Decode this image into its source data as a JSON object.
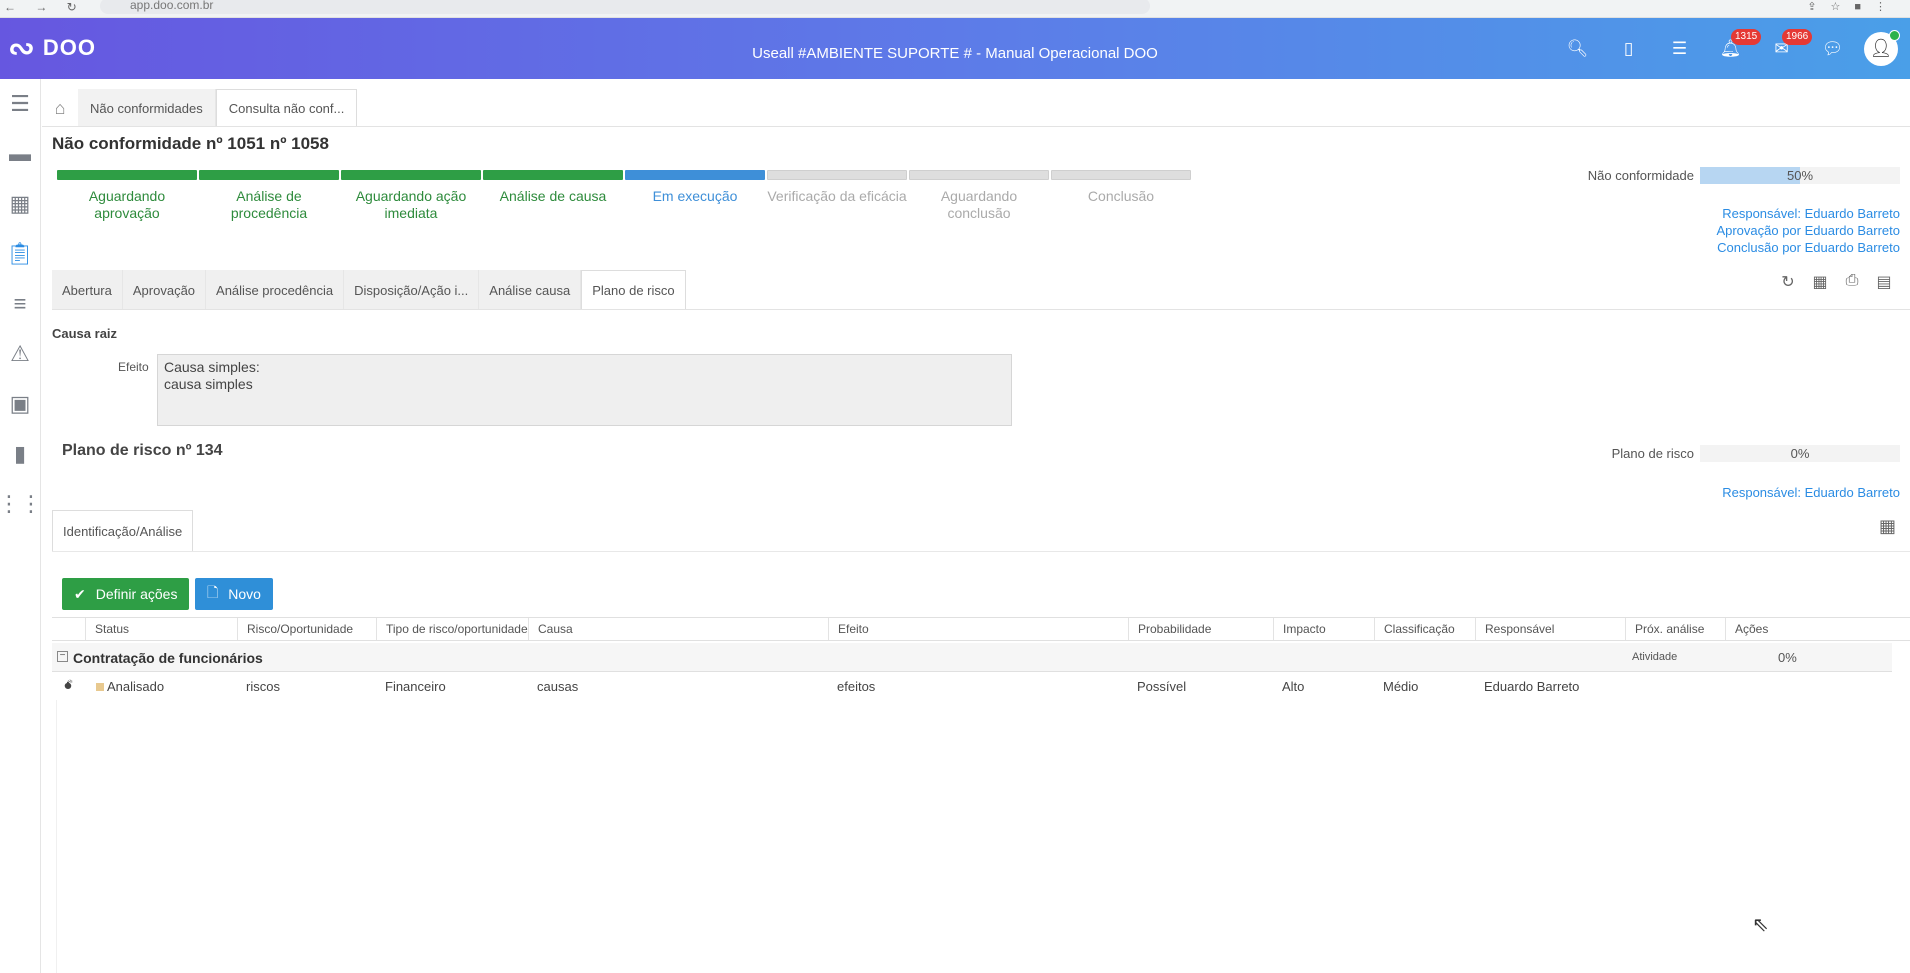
{
  "browser": {
    "url": "app.doo.com.br"
  },
  "header": {
    "logo_text": "DOO",
    "title": "Useall #AMBIENTE SUPORTE # - Manual Operacional DOO",
    "icons": [
      "search-icon",
      "mobile-icon",
      "list-icon",
      "bell-icon",
      "mail-icon",
      "chat-icon"
    ],
    "notifications_count": "1315",
    "mail_count": "1966"
  },
  "sidebar": {
    "items": [
      "menu-icon",
      "folder-icon",
      "calendar-icon",
      "clipboard-icon",
      "notes-icon",
      "warning-icon",
      "contact-icon",
      "chart-icon",
      "apps-icon"
    ]
  },
  "tabs": {
    "items": [
      {
        "label": "Não conformidades"
      },
      {
        "label": "Consulta não conf..."
      }
    ]
  },
  "page": {
    "title": "Não conformidade nº 1051 nº 1058"
  },
  "stages": [
    {
      "label": "Aguardando aprovação",
      "state": "done"
    },
    {
      "label": "Análise de procedência",
      "state": "done"
    },
    {
      "label": "Aguardando ação imediata",
      "state": "done"
    },
    {
      "label": "Análise de causa",
      "state": "done"
    },
    {
      "label": "Em execução",
      "state": "current"
    },
    {
      "label": "Verificação da eficácia",
      "state": "pending"
    },
    {
      "label": "Aguardando conclusão",
      "state": "pending"
    },
    {
      "label": "Conclusão",
      "state": "pending"
    }
  ],
  "nc_progress": {
    "label": "Não conformidade",
    "value_text": "50%",
    "value": 0.5
  },
  "nc_resp": {
    "responsavel": "Responsável: Eduardo Barreto",
    "aprovacao": "Aprovação por Eduardo Barreto",
    "conclusao": "Conclusão por Eduardo Barreto"
  },
  "subtabs": [
    {
      "label": "Abertura"
    },
    {
      "label": "Aprovação"
    },
    {
      "label": "Análise procedência"
    },
    {
      "label": "Disposição/Ação i..."
    },
    {
      "label": "Análise causa"
    },
    {
      "label": "Plano de risco"
    }
  ],
  "tools": [
    "refresh-icon",
    "calendar-icon",
    "print-icon",
    "comment-icon"
  ],
  "causa": {
    "section_title": "Causa raiz",
    "efeito_label": "Efeito",
    "efeito_value": "Causa simples:\ncausa simples"
  },
  "plan": {
    "title": "Plano de risco nº 134",
    "progress_label": "Plano de risco",
    "progress_text": "0%",
    "progress": 0,
    "responsavel": "Responsável: Eduardo Barreto",
    "tab_label": "Identificação/Análise"
  },
  "buttons": {
    "definir": "Definir ações",
    "novo": "Novo"
  },
  "table": {
    "columns": [
      "Status",
      "Risco/Oportunidade",
      "Tipo de risco/oportunidade",
      "Causa",
      "Efeito",
      "Probabilidade",
      "Impacto",
      "Classificação",
      "Responsável",
      "Próx. análise",
      "Ações"
    ],
    "group": {
      "name": "Contratação de funcionários",
      "atividade": "Atividade",
      "percent": "0%"
    },
    "rows": [
      {
        "status": "Analisado",
        "risco": "riscos",
        "tipo": "Financeiro",
        "causa": "causas",
        "efeito": "efeitos",
        "probabilidade": "Possível",
        "impacto": "Alto",
        "classificacao": "Médio",
        "responsavel": "Eduardo Barreto"
      }
    ]
  }
}
